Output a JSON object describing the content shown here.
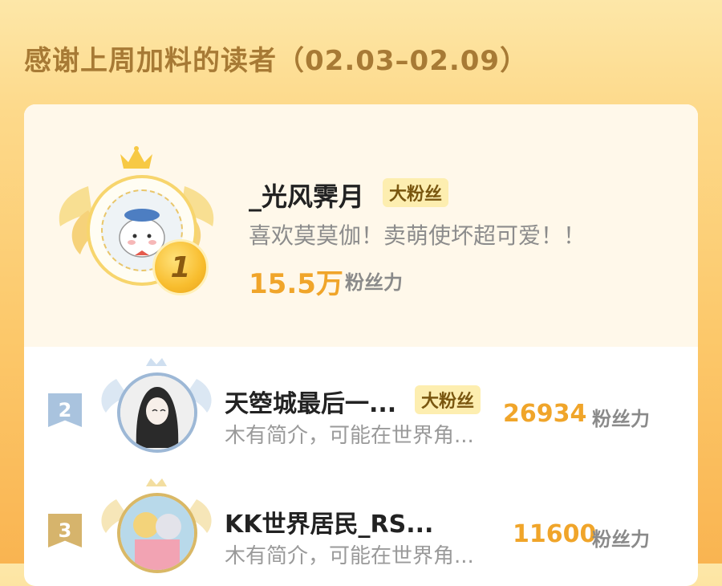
{
  "header": {
    "title": "感谢上周加料的读者（02.03–02.09）"
  },
  "top_reader": {
    "rank": "1",
    "name": "_光风霁月",
    "tag": "大粉丝",
    "description": "喜欢莫莫伽！卖萌使坏超可爱！！",
    "fans_value": "15.5万",
    "fans_label": "粉丝力"
  },
  "readers": [
    {
      "rank": "2",
      "name": "天箜城最后一...",
      "tag": "大粉丝",
      "description": "木有简介，可能在世界角...",
      "fans_value": "26934",
      "fans_label": "粉丝力"
    },
    {
      "rank": "3",
      "name": "KK世界居民_RS...",
      "description": "木有简介，可能在世界角...",
      "fans_value": "11600",
      "fans_label": "粉丝力"
    }
  ],
  "colors": {
    "accent_orange": "#f0a52a",
    "gold": "#f7d56d",
    "silver_blue": "#a9c3de",
    "bronze": "#d6b46c"
  }
}
